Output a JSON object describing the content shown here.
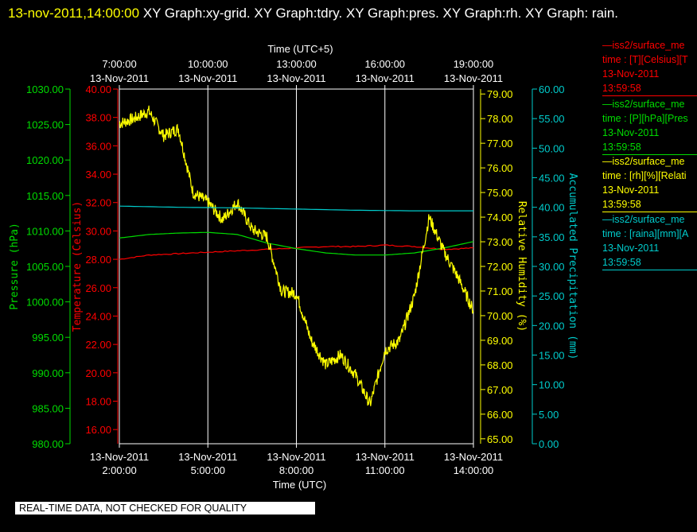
{
  "title": {
    "timestamp": "13-nov-2011,14:00:00",
    "rest": "  XY Graph:xy-grid.  XY Graph:tdry.  XY Graph:pres.  XY Graph:rh.  XY Graph: rain."
  },
  "colors": {
    "pressure": "#00dd00",
    "temperature": "#ff0000",
    "humidity": "#ffff00",
    "precip": "#00cccc",
    "grid": "#ffffff"
  },
  "legend": [
    {
      "line": "—iss2/surface_me",
      "var": "time : [T][Celsius][T",
      "date": "13-Nov-2011",
      "time": "13:59:58",
      "color": "#ff0000"
    },
    {
      "line": "—iss2/surface_me",
      "var": "time : [P][hPa][Pres",
      "date": "13-Nov-2011",
      "time": "13:59:58",
      "color": "#00dd00"
    },
    {
      "line": "—iss2/surface_me",
      "var": "time : [rh][%][Relati",
      "date": "13-Nov-2011",
      "time": "13:59:58",
      "color": "#ffff00"
    },
    {
      "line": "—iss2/surface_me",
      "var": "time : [raina][mm][A",
      "date": "13-Nov-2011",
      "time": "13:59:58",
      "color": "#00cccc"
    }
  ],
  "quality_note": "REAL-TIME DATA, NOT CHECKED FOR QUALITY",
  "chart_data": {
    "type": "line",
    "top_axis": {
      "label": "Time (UTC+5)",
      "ticks": [
        {
          "time": "7:00:00",
          "date": "13-Nov-2011"
        },
        {
          "time": "10:00:00",
          "date": "13-Nov-2011"
        },
        {
          "time": "13:00:00",
          "date": "13-Nov-2011"
        },
        {
          "time": "16:00:00",
          "date": "13-Nov-2011"
        },
        {
          "time": "19:00:00",
          "date": "13-Nov-2011"
        }
      ]
    },
    "bottom_axis": {
      "label": "Time (UTC)",
      "range": [
        "2011-11-13 02:00:00",
        "2011-11-13 14:00:00"
      ],
      "ticks": [
        {
          "date": "13-Nov-2011",
          "time": "2:00:00"
        },
        {
          "date": "13-Nov-2011",
          "time": "5:00:00"
        },
        {
          "date": "13-Nov-2011",
          "time": "8:00:00"
        },
        {
          "date": "13-Nov-2011",
          "time": "11:00:00"
        },
        {
          "date": "13-Nov-2011",
          "time": "14:00:00"
        }
      ]
    },
    "grid": "vertical lines at bottom-axis ticks",
    "y_axes": [
      {
        "label": "Pressure (hPa)",
        "range": [
          980,
          1030
        ],
        "ticks": [
          "980.00",
          "985.00",
          "990.00",
          "995.00",
          "1000.00",
          "1005.00",
          "1010.00",
          "1015.00",
          "1020.00",
          "1025.00",
          "1030.00"
        ]
      },
      {
        "label": "Temperature (Celsius)",
        "range": [
          15,
          40
        ],
        "ticks": [
          "16.00",
          "18.00",
          "20.00",
          "22.00",
          "24.00",
          "26.00",
          "28.00",
          "30.00",
          "32.00",
          "34.00",
          "36.00",
          "38.00",
          "40.00"
        ]
      },
      {
        "label": "Relative Humidity (%)",
        "range": [
          64.8,
          79.2
        ],
        "ticks": [
          "65.00",
          "66.00",
          "67.00",
          "68.00",
          "69.00",
          "70.00",
          "71.00",
          "72.00",
          "73.00",
          "74.00",
          "75.00",
          "76.00",
          "77.00",
          "78.00",
          "79.00"
        ]
      },
      {
        "label": "Accumulated Precipitation (mm)",
        "range": [
          0,
          60
        ],
        "ticks": [
          "0.00",
          "5.00",
          "10.00",
          "15.00",
          "20.00",
          "25.00",
          "30.00",
          "35.00",
          "40.00",
          "45.00",
          "50.00",
          "55.00",
          "60.00"
        ]
      }
    ],
    "series": [
      {
        "name": "Temperature",
        "axis": 1,
        "x": [
          "2011-11-13 02:00",
          "2011-11-13 03:00",
          "2011-11-13 04:00",
          "2011-11-13 05:00",
          "2011-11-13 06:00",
          "2011-11-13 07:00",
          "2011-11-13 08:00",
          "2011-11-13 09:00",
          "2011-11-13 10:00",
          "2011-11-13 11:00",
          "2011-11-13 12:00",
          "2011-11-13 13:00",
          "2011-11-13 14:00"
        ],
        "y": [
          28.0,
          28.3,
          28.4,
          28.5,
          28.6,
          28.7,
          28.8,
          28.9,
          28.9,
          29.0,
          28.9,
          28.7,
          28.8
        ]
      },
      {
        "name": "Pressure",
        "axis": 0,
        "x": [
          "2011-11-13 02:00",
          "2011-11-13 03:00",
          "2011-11-13 04:00",
          "2011-11-13 05:00",
          "2011-11-13 06:00",
          "2011-11-13 07:00",
          "2011-11-13 08:00",
          "2011-11-13 09:00",
          "2011-11-13 10:00",
          "2011-11-13 11:00",
          "2011-11-13 12:00",
          "2011-11-13 13:00",
          "2011-11-13 14:00"
        ],
        "y": [
          1009.0,
          1009.5,
          1009.7,
          1009.8,
          1009.5,
          1008.3,
          1007.5,
          1006.9,
          1006.6,
          1006.6,
          1006.9,
          1007.6,
          1008.5
        ]
      },
      {
        "name": "Relative Humidity",
        "axis": 2,
        "x": [
          "2011-11-13 02:00",
          "2011-11-13 02:30",
          "2011-11-13 03:00",
          "2011-11-13 03:30",
          "2011-11-13 04:00",
          "2011-11-13 04:30",
          "2011-11-13 05:00",
          "2011-11-13 05:30",
          "2011-11-13 06:00",
          "2011-11-13 06:30",
          "2011-11-13 07:00",
          "2011-11-13 07:30",
          "2011-11-13 08:00",
          "2011-11-13 08:30",
          "2011-11-13 09:00",
          "2011-11-13 09:30",
          "2011-11-13 10:00",
          "2011-11-13 10:30",
          "2011-11-13 11:00",
          "2011-11-13 11:30",
          "2011-11-13 12:00",
          "2011-11-13 12:30",
          "2011-11-13 13:00",
          "2011-11-13 13:30",
          "2011-11-13 14:00"
        ],
        "y": [
          77.8,
          78.0,
          78.3,
          77.3,
          77.6,
          75.0,
          74.6,
          73.9,
          74.6,
          73.5,
          73.2,
          71.0,
          70.9,
          69.0,
          68.0,
          68.4,
          67.6,
          66.4,
          68.6,
          69.0,
          70.8,
          74.0,
          72.6,
          71.5,
          70.2
        ]
      },
      {
        "name": "Accumulated Precipitation",
        "axis": 3,
        "x": [
          "2011-11-13 02:00",
          "2011-11-13 04:00",
          "2011-11-13 06:00",
          "2011-11-13 08:00",
          "2011-11-13 10:00",
          "2011-11-13 12:00",
          "2011-11-13 14:00"
        ],
        "y": [
          40.2,
          40.0,
          39.9,
          39.7,
          39.5,
          39.4,
          39.4
        ]
      }
    ]
  }
}
